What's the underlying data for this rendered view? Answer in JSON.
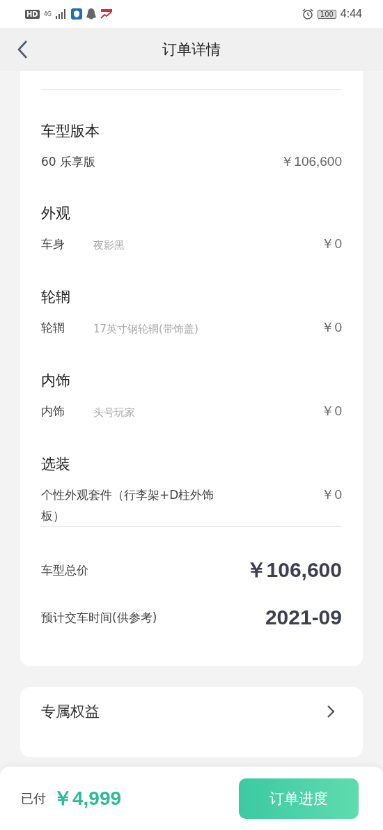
{
  "status_bar": {
    "hd": "HD",
    "network": "4G",
    "battery": "100",
    "time": "4:44"
  },
  "nav": {
    "title": "订单详情"
  },
  "sections": [
    {
      "title": "车型版本",
      "items": [
        {
          "label": "60 乐享版",
          "price": "￥106,600"
        }
      ]
    },
    {
      "title": "外观",
      "items": [
        {
          "label": "车身",
          "detail": "夜影黑",
          "price": "￥0"
        }
      ]
    },
    {
      "title": "轮辋",
      "items": [
        {
          "label": "轮辋",
          "detail": "17英寸钢轮辋(带饰盖)",
          "price": "￥0"
        }
      ]
    },
    {
      "title": "内饰",
      "items": [
        {
          "label": "内饰",
          "detail": "头号玩家",
          "price": "￥0"
        }
      ]
    },
    {
      "title": "选装",
      "items": [
        {
          "label": "个性外观套件（行李架+D柱外饰板）",
          "price": "￥0"
        }
      ]
    }
  ],
  "totals": [
    {
      "label": "车型总价",
      "value": "￥106,600"
    },
    {
      "label": "预计交车时间(供参考)",
      "value": "2021-09"
    }
  ],
  "benefits": {
    "label": "专属权益"
  },
  "bottom_bar": {
    "paid_label": "已付",
    "paid_amount": "￥4,999",
    "button": "订单进度"
  }
}
